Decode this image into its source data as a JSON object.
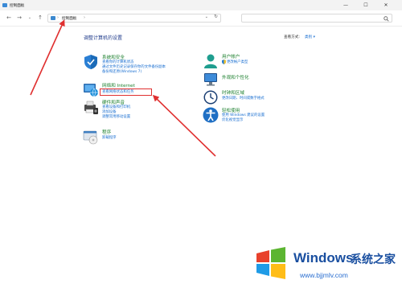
{
  "window": {
    "title": "控制面板",
    "controls": {
      "minimize": "—",
      "maximize": "☐",
      "close": "✕"
    }
  },
  "nav": {
    "back": "←",
    "forward": "→",
    "recent": "⌄",
    "up": "↑",
    "address": "控制面板",
    "breadcrumb_sep": "›",
    "dropdown": "⌄",
    "refresh": "↻",
    "search_placeholder": ""
  },
  "content": {
    "title": "调整计算机的设置",
    "view_by_label": "查看方式:",
    "view_by_value": "类别 ▾"
  },
  "categories_left": [
    {
      "title": "系统和安全",
      "icon": "shield-icon",
      "links": [
        "查看你的计算机状态",
        "通过文件历史记录保存你的文件备份副本",
        "备份和还原(Windows 7)"
      ]
    },
    {
      "title": "网络和 Internet",
      "icon": "network-icon",
      "links": [
        "查看网络状态和任务"
      ]
    },
    {
      "title": "硬件和声音",
      "icon": "printer-icon",
      "links": [
        "查看设备和打印机",
        "添加设备",
        "调整常用移动设置"
      ]
    },
    {
      "title": "程序",
      "icon": "programs-icon",
      "links": [
        "卸载程序"
      ]
    }
  ],
  "categories_right": [
    {
      "title": "用户帐户",
      "icon": "user-icon",
      "links": [
        "更改帐户类型"
      ]
    },
    {
      "title": "外观和个性化",
      "icon": "appearance-icon",
      "links": []
    },
    {
      "title": "时钟和区域",
      "icon": "clock-icon",
      "links": [
        "更改日期、时间或数字格式"
      ]
    },
    {
      "title": "轻松使用",
      "icon": "accessibility-icon",
      "links": [
        "使用 Windows 建议的设置",
        "优化视觉显示"
      ]
    }
  ],
  "watermark": {
    "brand": "Windows",
    "cn": "系统之家",
    "url": "www.bjjmlv.com"
  },
  "colors": {
    "link": "#1a6fd1",
    "category": "#1b7f2d",
    "annotation": "#e03030",
    "watermark": "#1a4fa0"
  }
}
